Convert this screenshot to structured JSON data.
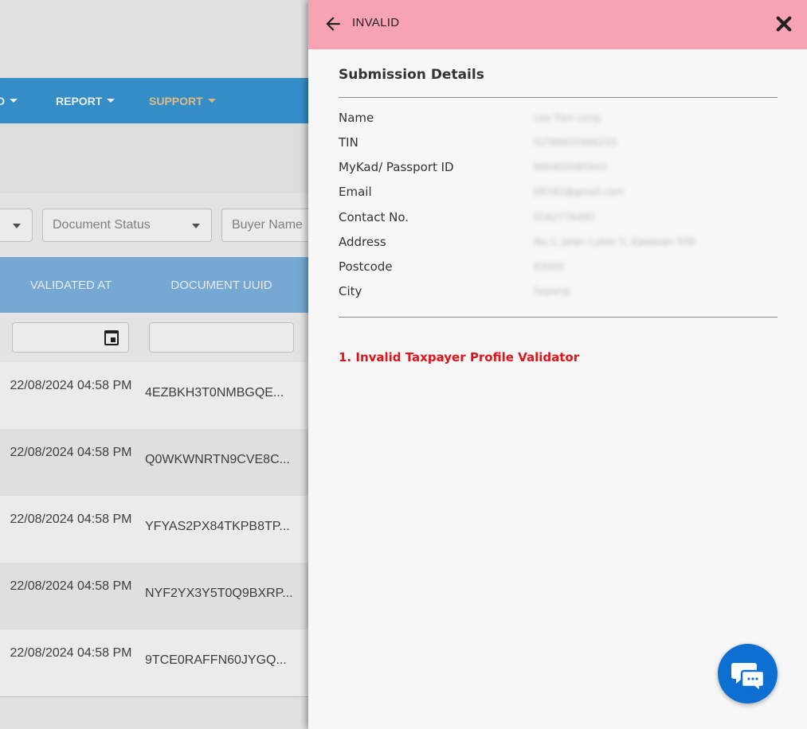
{
  "background": {
    "nav": {
      "partial_item": "D",
      "report": "REPORT",
      "support": "SUPPORT"
    },
    "filters": {
      "document_status": "Document Status",
      "buyer_name": "Buyer Name"
    },
    "table": {
      "headers": [
        "VALIDATED AT",
        "DOCUMENT UUID"
      ],
      "rows": [
        {
          "validated_at": "22/08/2024 04:58 PM",
          "uuid": "4EZBKH3T0NMBGQE..."
        },
        {
          "validated_at": "22/08/2024 04:58 PM",
          "uuid": "Q0WKWNRTN9CVE8C..."
        },
        {
          "validated_at": "22/08/2024 04:58 PM",
          "uuid": "YFYAS2PX84TKPB8TP..."
        },
        {
          "validated_at": "22/08/2024 04:58 PM",
          "uuid": "NYF2YX3Y5T0Q9BXRP..."
        },
        {
          "validated_at": "22/08/2024 04:58 PM",
          "uuid": "9TCE0RAFFN60JYGQ..."
        }
      ]
    }
  },
  "panel": {
    "status": "INVALID",
    "section_title": "Submission Details",
    "details": [
      {
        "label": "Name",
        "value": "Lee Tien Long"
      },
      {
        "label": "TIN",
        "value": "IG788935906235"
      },
      {
        "label": "MyKad/ Passport ID",
        "value": "840405085943"
      },
      {
        "label": "Email",
        "value": "jt9392@gmail.com"
      },
      {
        "label": "Contact No.",
        "value": "0162776492"
      },
      {
        "label": "Address",
        "value": "No.1, Jalan Cyber 5, Kawasan 508"
      },
      {
        "label": "Postcode",
        "value": "63000"
      },
      {
        "label": "City",
        "value": "Sepang"
      }
    ],
    "errors": [
      "1. Invalid Taxpayer Profile Validator"
    ]
  },
  "colors": {
    "header_pink": "#f8a3b5",
    "nav_blue": "#3a9ad9",
    "error_red": "#e0131a",
    "chat_blue": "#0d6fd1"
  },
  "icons": {
    "back": "arrow-left-icon",
    "close": "close-icon",
    "chat": "chat-bubbles-icon",
    "calendar": "calendar-icon"
  }
}
